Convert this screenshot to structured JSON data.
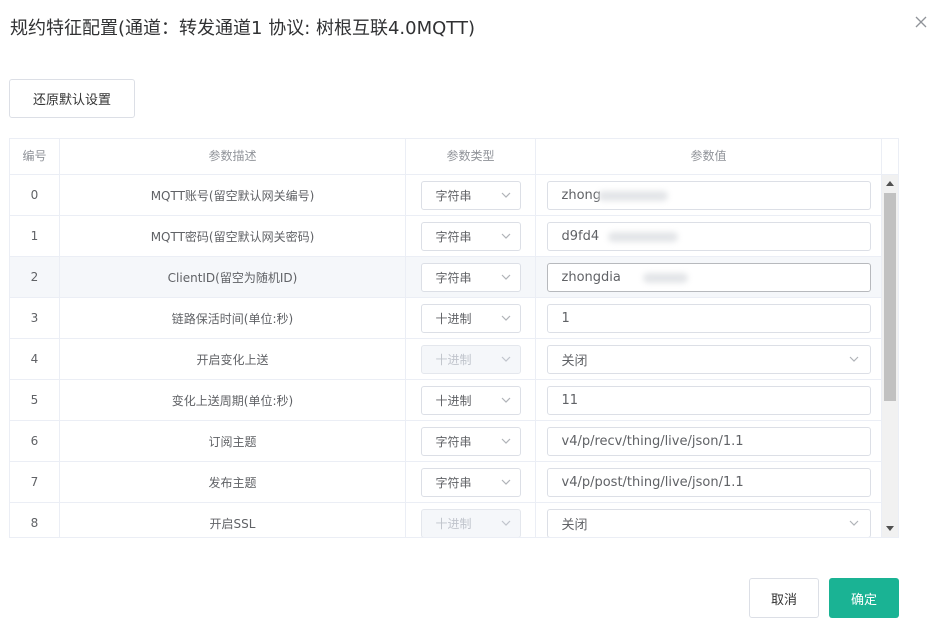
{
  "dialog": {
    "title": "规约特征配置(通道：转发通道1 协议: 树根互联4.0MQTT)"
  },
  "toolbar": {
    "reset_label": "还原默认设置"
  },
  "table": {
    "headers": [
      "编号",
      "参数描述",
      "参数类型",
      "参数值"
    ],
    "rows": [
      {
        "id": "0",
        "desc": "MQTT账号(留空默认网关编号)",
        "type": "字符串",
        "type_disabled": false,
        "value": "zhong",
        "value_kind": "input",
        "masked": true
      },
      {
        "id": "1",
        "desc": "MQTT密码(留空默认网关密码)",
        "type": "字符串",
        "type_disabled": false,
        "value": "d9fd4",
        "value_kind": "input",
        "masked": true
      },
      {
        "id": "2",
        "desc": "ClientID(留空为随机ID)",
        "type": "字符串",
        "type_disabled": false,
        "value": "zhongdia",
        "value_kind": "input",
        "masked": true
      },
      {
        "id": "3",
        "desc": "链路保活时间(单位:秒)",
        "type": "十进制",
        "type_disabled": false,
        "value": "1",
        "value_kind": "input",
        "masked": false
      },
      {
        "id": "4",
        "desc": "开启变化上送",
        "type": "十进制",
        "type_disabled": true,
        "value": "关闭",
        "value_kind": "select",
        "masked": false
      },
      {
        "id": "5",
        "desc": "变化上送周期(单位:秒)",
        "type": "十进制",
        "type_disabled": false,
        "value": "11",
        "value_kind": "input",
        "masked": false
      },
      {
        "id": "6",
        "desc": "订阅主题",
        "type": "字符串",
        "type_disabled": false,
        "value": "v4/p/recv/thing/live/json/1.1",
        "value_kind": "input",
        "masked": false
      },
      {
        "id": "7",
        "desc": "发布主题",
        "type": "字符串",
        "type_disabled": false,
        "value": "v4/p/post/thing/live/json/1.1",
        "value_kind": "input",
        "masked": false
      },
      {
        "id": "8",
        "desc": "开启SSL",
        "type": "十进制",
        "type_disabled": true,
        "value": "关闭",
        "value_kind": "select",
        "masked": false
      }
    ]
  },
  "footer": {
    "cancel_label": "取消",
    "confirm_label": "确定"
  },
  "colors": {
    "primary": "#1ab394",
    "border": "#dcdfe6",
    "header_text": "#909399"
  }
}
